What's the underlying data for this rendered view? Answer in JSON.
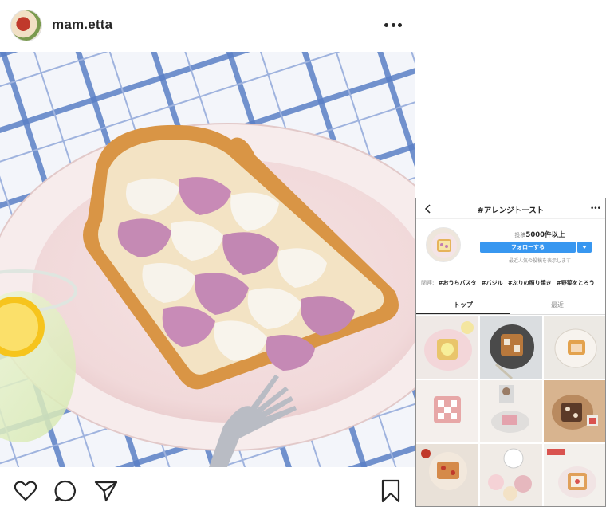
{
  "post": {
    "username": "mam.etta",
    "photo_alt": ""
  },
  "icons": {
    "avatar": "profile-avatar",
    "more": "more-dots-icon",
    "like": "heart-icon",
    "comment": "comment-icon",
    "share": "send-icon",
    "save": "bookmark-icon"
  },
  "inset": {
    "title": "#アレンジトースト",
    "posts_label": "投稿",
    "posts_count": "5000件以上",
    "follow_label": "フォローする",
    "recent_note": "最近人気の投稿を表示します",
    "related_label": "関連:",
    "related_tags": [
      "#おうちパスタ",
      "#バジル",
      "#ぶりの照り焼き",
      "#野菜をとろう"
    ],
    "tabs": [
      "トップ",
      "最近"
    ],
    "grid_cells": 9
  },
  "colors": {
    "follow_blue": "#3897f0",
    "text": "#262626",
    "muted": "#8e8e8e"
  }
}
